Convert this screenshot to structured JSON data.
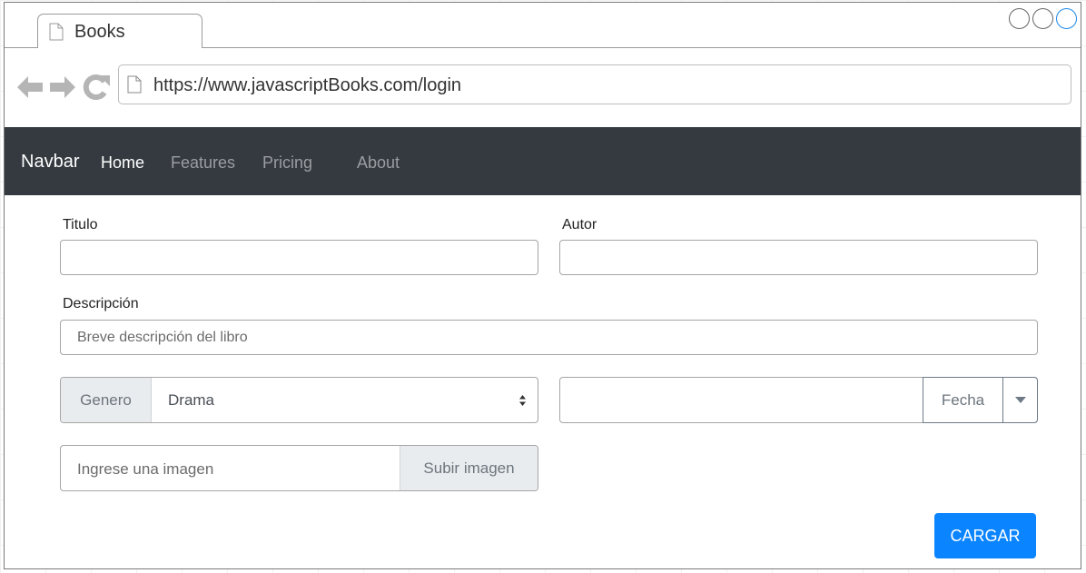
{
  "browser": {
    "tab_title": "Books",
    "url": "https://www.javascriptBooks.com/login"
  },
  "navbar": {
    "brand": "Navbar",
    "links": [
      "Home",
      "Features",
      "Pricing",
      "About"
    ],
    "active": "Home"
  },
  "form": {
    "titulo_label": "Titulo",
    "autor_label": "Autor",
    "descripcion_label": "Descripción",
    "descripcion_placeholder": "Breve descripción del libro",
    "genero_addon": "Genero",
    "genero_value": "Drama",
    "fecha_addon": "Fecha",
    "imagen_placeholder": "Ingrese una imagen",
    "imagen_button": "Subir imagen",
    "submit": "CARGAR"
  },
  "colors": {
    "navbar_bg": "#343a40",
    "primary": "#0a84ff"
  },
  "icons": [
    "page-icon",
    "back-arrow-icon",
    "forward-arrow-icon",
    "refresh-icon",
    "caret-down-icon",
    "select-arrows-icon"
  ]
}
